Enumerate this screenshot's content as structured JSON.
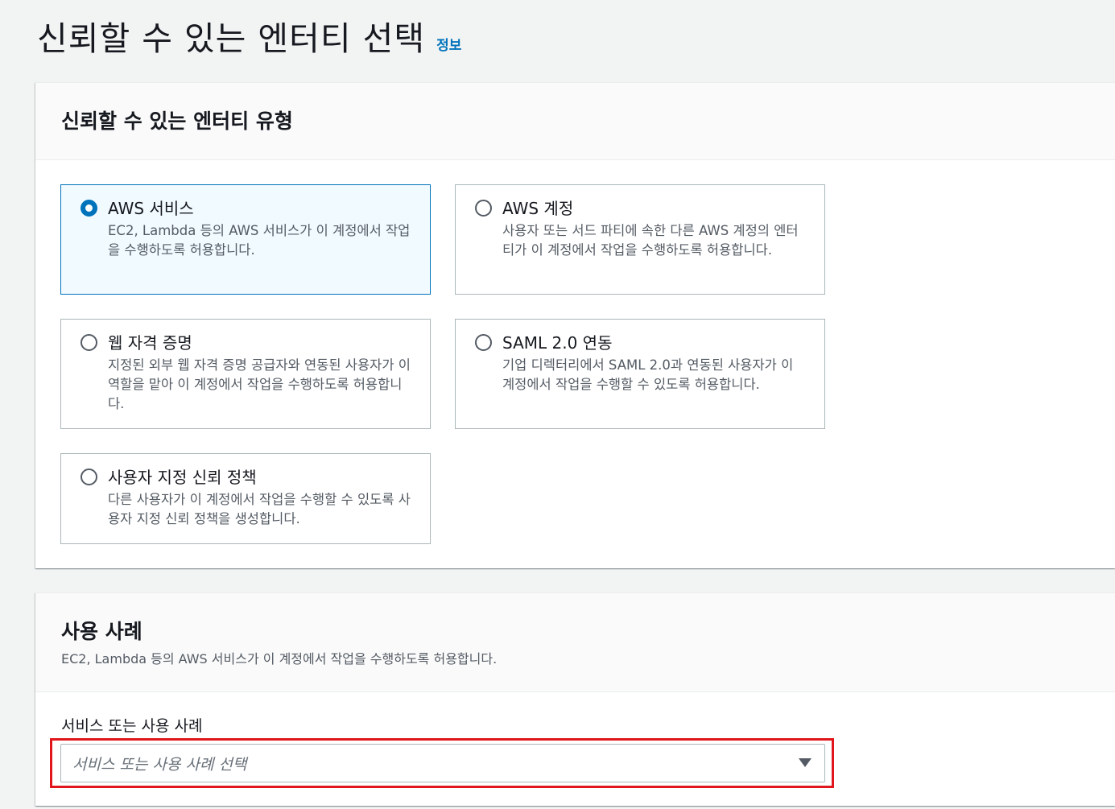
{
  "header": {
    "title": "신뢰할 수 있는 엔터티 선택",
    "info_link": "정보"
  },
  "entity_type_panel": {
    "heading": "신뢰할 수 있는 엔터티 유형",
    "options": [
      {
        "title": "AWS 서비스",
        "description": "EC2, Lambda 등의 AWS 서비스가 이 계정에서 작업을 수행하도록 허용합니다.",
        "selected": true
      },
      {
        "title": "AWS 계정",
        "description": "사용자 또는 서드 파티에 속한 다른 AWS 계정의 엔터티가 이 계정에서 작업을 수행하도록 허용합니다.",
        "selected": false
      },
      {
        "title": "웹 자격 증명",
        "description": "지정된 외부 웹 자격 증명 공급자와 연동된 사용자가 이 역할을 맡아 이 계정에서 작업을 수행하도록 허용합니다.",
        "selected": false
      },
      {
        "title": "SAML 2.0 연동",
        "description": "기업 디렉터리에서 SAML 2.0과 연동된 사용자가 이 계정에서 작업을 수행할 수 있도록 허용합니다.",
        "selected": false
      },
      {
        "title": "사용자 지정 신뢰 정책",
        "description": "다른 사용자가 이 계정에서 작업을 수행할 수 있도록 사용자 지정 신뢰 정책을 생성합니다.",
        "selected": false
      }
    ]
  },
  "use_case_panel": {
    "heading": "사용 사례",
    "description": "EC2, Lambda 등의 AWS 서비스가 이 계정에서 작업을 수행하도록 허용합니다.",
    "field_label": "서비스 또는 사용 사례",
    "select_placeholder": "서비스 또는 사용 사례 선택",
    "caret_icon": "caret-down-icon"
  },
  "colors": {
    "accent": "#0073bb",
    "selected_bg": "#f1faff",
    "highlight": "#e0161c"
  }
}
